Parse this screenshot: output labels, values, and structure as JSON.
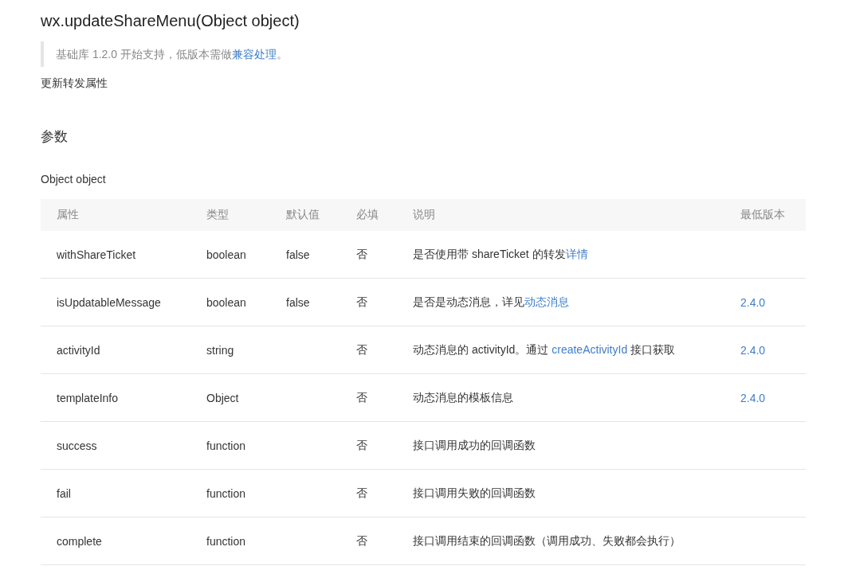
{
  "title": "wx.updateShareMenu(Object object)",
  "notice": [
    {
      "text": "基础库 1.2.0 开始支持，低版本需做",
      "link": false
    },
    {
      "text": "兼容处理",
      "link": true
    },
    {
      "text": "。",
      "link": false
    }
  ],
  "description": "更新转发属性",
  "section_heading": "参数",
  "param_label": "Object object",
  "table": {
    "columns": [
      "属性",
      "类型",
      "默认值",
      "必填",
      "说明",
      "最低版本"
    ],
    "rows": [
      {
        "name": "withShareTicket",
        "type": "boolean",
        "default": "false",
        "required": "否",
        "desc": [
          {
            "text": "是否使用带 shareTicket 的转发",
            "link": false
          },
          {
            "text": "详情",
            "link": true
          }
        ],
        "version": ""
      },
      {
        "name": "isUpdatableMessage",
        "type": "boolean",
        "default": "false",
        "required": "否",
        "desc": [
          {
            "text": "是否是动态消息，详见",
            "link": false
          },
          {
            "text": "动态消息",
            "link": true
          }
        ],
        "version": "2.4.0"
      },
      {
        "name": "activityId",
        "type": "string",
        "default": "",
        "required": "否",
        "desc": [
          {
            "text": "动态消息的 activityId。通过 ",
            "link": false
          },
          {
            "text": "createActivityId",
            "link": true
          },
          {
            "text": " 接口获取",
            "link": false
          }
        ],
        "version": "2.4.0"
      },
      {
        "name": "templateInfo",
        "type": "Object",
        "default": "",
        "required": "否",
        "desc": [
          {
            "text": "动态消息的模板信息",
            "link": false
          }
        ],
        "version": "2.4.0"
      },
      {
        "name": "success",
        "type": "function",
        "default": "",
        "required": "否",
        "desc": [
          {
            "text": "接口调用成功的回调函数",
            "link": false
          }
        ],
        "version": ""
      },
      {
        "name": "fail",
        "type": "function",
        "default": "",
        "required": "否",
        "desc": [
          {
            "text": "接口调用失败的回调函数",
            "link": false
          }
        ],
        "version": ""
      },
      {
        "name": "complete",
        "type": "function",
        "default": "",
        "required": "否",
        "desc": [
          {
            "text": "接口调用结束的回调函数（调用成功、失败都会执行）",
            "link": false
          }
        ],
        "version": ""
      }
    ]
  }
}
